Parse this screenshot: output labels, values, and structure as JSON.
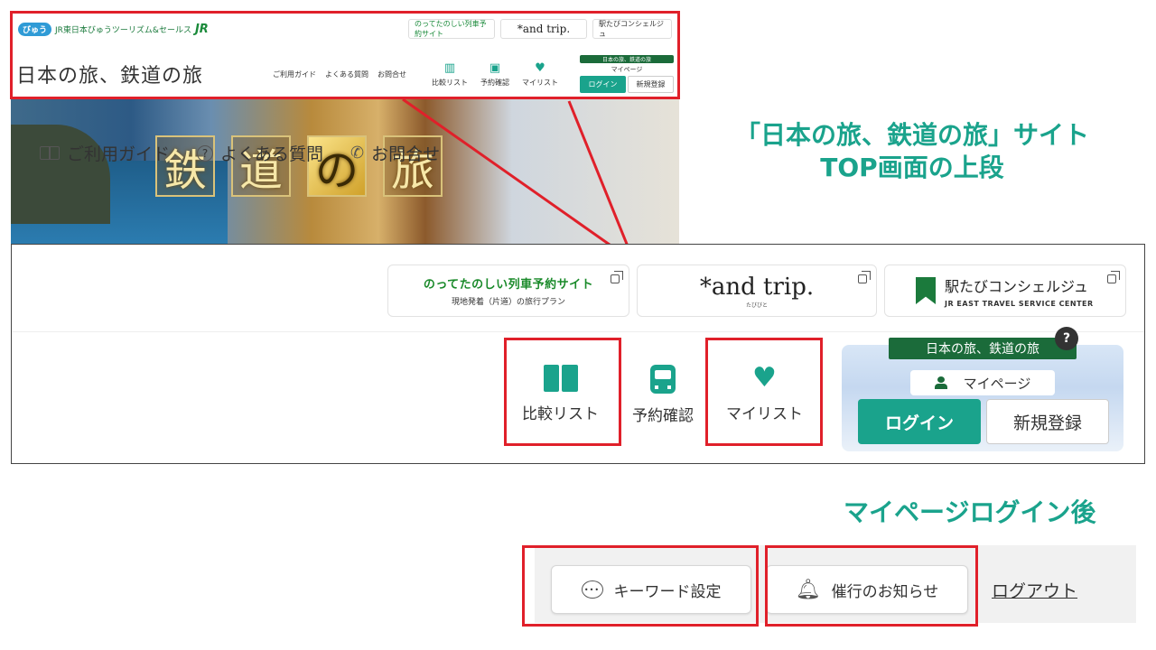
{
  "mini": {
    "topbar_logo_badge": "びゅう",
    "topbar_logo_text": "JR東日本びゅうツーリズム&セールス",
    "topbar_jr": "JR",
    "links": [
      "のってたのしい列車予約サイト",
      "*and trip.",
      "駅たびコンシェルジュ"
    ],
    "brand": "日本の旅、鉄道の旅",
    "menu": [
      "ご利用ガイド",
      "よくある質問",
      "お問合せ"
    ],
    "icons": [
      "比較リスト",
      "予約確認",
      "マイリスト"
    ],
    "mypage_banner": "日本の旅、鉄道の旅",
    "mypage_label": "マイページ",
    "login": "ログイン",
    "signup": "新規登録",
    "hero_chars": [
      "鉄",
      "道",
      "の",
      "旅"
    ]
  },
  "zoom": {
    "link1_title": "のってたのしい列車予約サイト",
    "link1_sub": "現地発着（片道）の旅行プラン",
    "link2_title": "*and trip.",
    "link2_sub": "たびびと",
    "link3_title": "駅たびコンシェルジュ",
    "link3_sub": "JR EAST TRAVEL SERVICE CENTER",
    "menu": {
      "guide": "ご利用ガイド",
      "faq": "よくある質問",
      "contact": "お問合せ"
    },
    "compare": "比較リスト",
    "reservation": "予約確認",
    "mylist": "マイリスト",
    "mypage_banner": "日本の旅、鉄道の旅",
    "mypage_help": "?",
    "mypage_label": "マイページ",
    "login": "ログイン",
    "signup": "新規登録"
  },
  "captions": {
    "site_title_line1": "「日本の旅、鉄道の旅」サイト",
    "site_title_line2": "TOP画面の上段",
    "after_login": "マイページログイン後"
  },
  "after": {
    "keyword": "キーワード設定",
    "notice": "催行のお知らせ",
    "logout": "ログアウト"
  },
  "colors": {
    "accent": "#1aa38c",
    "highlight": "#e0202a",
    "dark_green": "#1b6b3a"
  }
}
